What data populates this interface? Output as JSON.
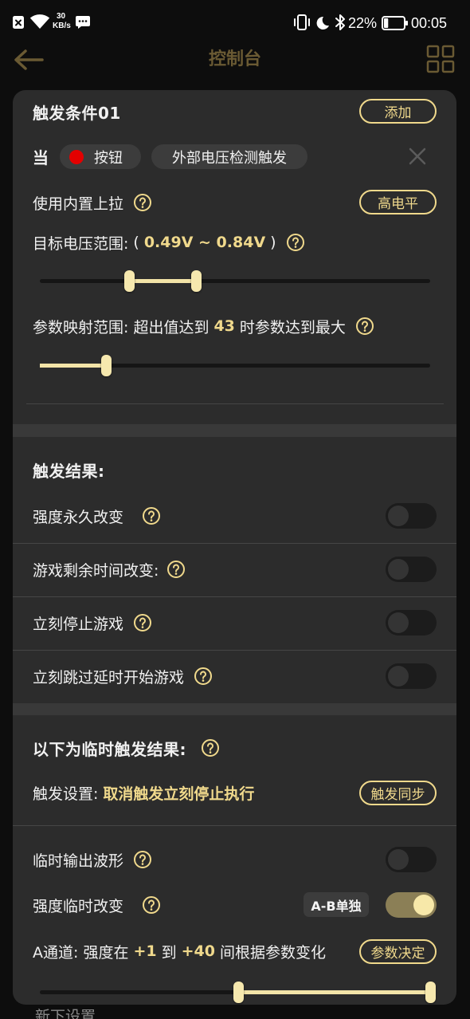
{
  "status_bar": {
    "net_speed": "30",
    "net_speed_unit": "KB/s",
    "battery": "22%",
    "battery_level": 0.22,
    "time": "00:05"
  },
  "header": {
    "title": "控制台",
    "back_icon": "arrow-left-icon",
    "menu_icon": "grid-icon"
  },
  "condition": {
    "title": "触发条件01",
    "add_button": "添加",
    "when": "当",
    "source_chip": "按钮",
    "source_dot_color": "#e30000",
    "trigger_type_chip": "外部电压检测触发",
    "pullup": {
      "label": "使用内置上拉",
      "button": "高电平"
    },
    "voltage": {
      "label": "目标电压范围:",
      "open_paren": "(",
      "value": "0.49V ~ 0.84V",
      "close_paren": ")",
      "slider_low": 0.23,
      "slider_high": 0.4
    },
    "param_map": {
      "label": "参数映射范围: 超出值达到",
      "value": "43",
      "suffix": "时参数达到最大",
      "slider_value": 0.17
    }
  },
  "results": {
    "title": "触发结果:",
    "toggles": [
      {
        "label": "强度永久改变",
        "on": false
      },
      {
        "label": "游戏剩余时间改变:",
        "on": false
      },
      {
        "label": "立刻停止游戏",
        "on": false
      },
      {
        "label": "立刻跳过延时开始游戏",
        "on": false
      }
    ]
  },
  "temp_results": {
    "title": "以下为临时触发结果:",
    "trigger_setting": {
      "label": "触发设置:",
      "value": "取消触发立刻停止执行",
      "button": "触发同步"
    },
    "waveform": {
      "label": "临时输出波形",
      "on": false
    },
    "strength": {
      "label": "强度临时改变",
      "mode_chip": "A-B单独",
      "on": true
    },
    "channel_a": {
      "label": "A通道: 强度在",
      "from": "+1",
      "joiner": "到",
      "to": "+40",
      "suffix": "间根据参数变化",
      "button": "参数决定",
      "slider_low": 0.51,
      "slider_high": 1.0
    }
  },
  "next_section_peek": "新下设置",
  "colors": {
    "accent": "#f0d98c",
    "header_muted": "#6a5a33",
    "toggle_on": "#8b7f56"
  }
}
